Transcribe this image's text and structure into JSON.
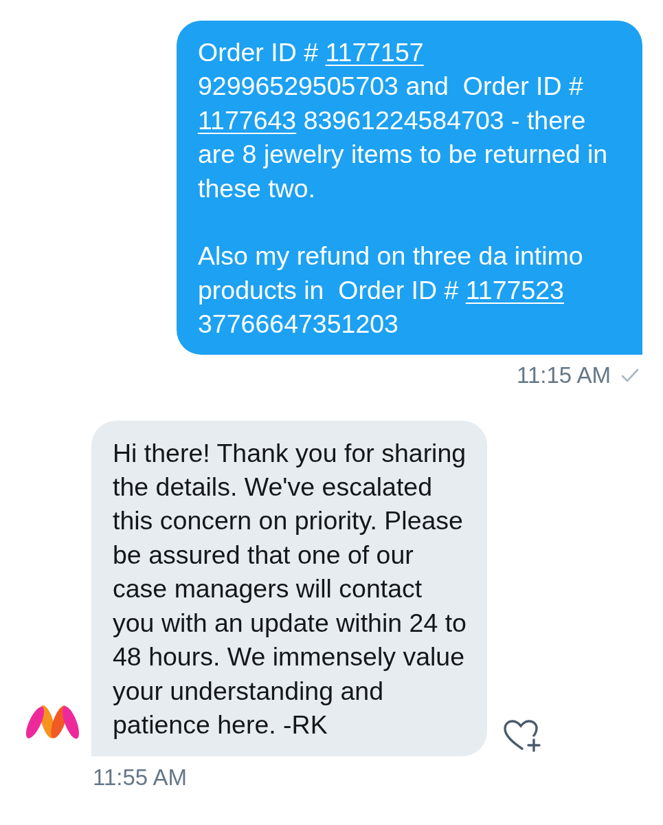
{
  "messages": [
    {
      "kind": "outgoing",
      "segments": [
        {
          "kind": "text",
          "text": "Order ID # "
        },
        {
          "kind": "link",
          "text": "1177157"
        },
        {
          "kind": "text",
          "text": " 92996529505703 and  Order ID # "
        },
        {
          "kind": "link",
          "text": "1177643"
        },
        {
          "kind": "text",
          "text": " 83961224584703 - there are 8 jewelry items to be returned in these two.\n\nAlso my refund on three da intimo products in  Order ID # "
        },
        {
          "kind": "link",
          "text": "1177523"
        },
        {
          "kind": "text",
          "text": " 37766647351203"
        }
      ],
      "time": "11:15 AM",
      "sent": true
    },
    {
      "kind": "incoming",
      "segments": [
        {
          "kind": "text",
          "text": "Hi there! Thank you for sharing the details. We've escalated this concern on priority. Please be assured that one of our case managers will contact you with an update within 24 to 48 hours. We immensely value your understanding and patience here. -RK"
        }
      ],
      "time": "11:55 AM",
      "liked": false
    }
  ]
}
